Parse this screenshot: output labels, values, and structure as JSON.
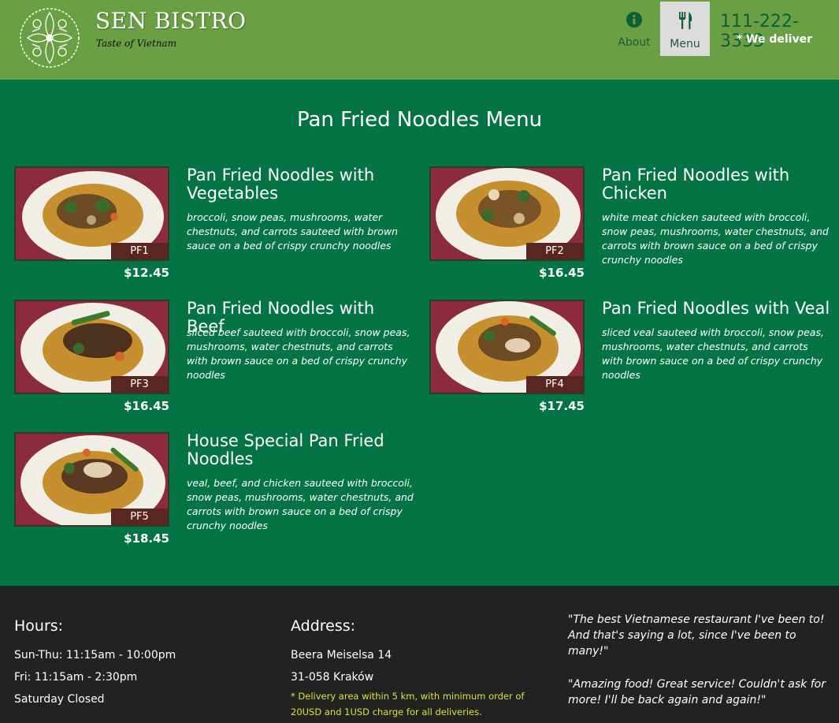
{
  "header": {
    "brand_name": "SEN BISTRO",
    "tagline": "Taste of Vietnam",
    "nav": {
      "about_label": "About",
      "menu_label": "Menu"
    },
    "phone": "111-222-3333",
    "delivery_note": "* We deliver"
  },
  "main": {
    "title": "Pan Fried Noodles Menu",
    "items": [
      {
        "code": "PF1",
        "name": "Pan Fried Noodles with Vegetables",
        "description": "broccoli, snow peas, mushrooms, water chestnuts, and carrots sauteed with brown sauce on a bed of crispy crunchy noodles",
        "price": "$12.45"
      },
      {
        "code": "PF2",
        "name": "Pan Fried Noodles with Chicken",
        "description": "white meat chicken sauteed with broccoli, snow peas, mushrooms, water chestnuts, and carrots with brown sauce on a bed of crispy crunchy noodles",
        "price": "$16.45"
      },
      {
        "code": "PF3",
        "name": "Pan Fried Noodles with Beef",
        "description": "sliced beef sauteed with broccoli, snow peas, mushrooms, water chestnuts, and carrots with brown sauce on a bed of crispy crunchy noodles",
        "price": "$16.45"
      },
      {
        "code": "PF4",
        "name": "Pan Fried Noodles with Veal",
        "description": "sliced veal sauteed with broccoli, snow peas, mushrooms, water chestnuts, and carrots with brown sauce on a bed of crispy crunchy noodles",
        "price": "$17.45"
      },
      {
        "code": "PF5",
        "name": "House Special Pan Fried Noodles",
        "description": "veal, beef, and chicken sauteed with broccoli, snow peas, mushrooms, water chestnuts, and carrots with brown sauce on a bed of crispy crunchy noodles",
        "price": "$18.45"
      }
    ]
  },
  "footer": {
    "hours": {
      "heading": "Hours:",
      "lines": [
        "Sun-Thu: 11:15am - 10:00pm",
        "Fri: 11:15am - 2:30pm",
        "Saturday Closed"
      ]
    },
    "address": {
      "heading": "Address:",
      "lines": [
        "Beera Meiselsa 14",
        "31-058 Kraków"
      ],
      "delivery_note": "* Delivery area within 5 km, with minimum order of 20USD and 1USD charge for all deliveries."
    },
    "testimonials": [
      "\"The best Vietnamese restaurant I've been to! And that's saying a lot, since I've been to many!\"",
      "\"Amazing food! Great service! Couldn't ask for more! I'll be back again and again!\""
    ]
  },
  "colors": {
    "header_bg": "#6a9f44",
    "main_bg": "#047446",
    "footer_bg": "#222222",
    "code_badge": "#5a2720",
    "accent_green": "#0e5f36",
    "note_yellow": "#d8e23a"
  },
  "icons": {
    "logo": "floral-wreath-logo-icon",
    "about": "info-circle-icon",
    "menu": "fork-knife-icon"
  }
}
